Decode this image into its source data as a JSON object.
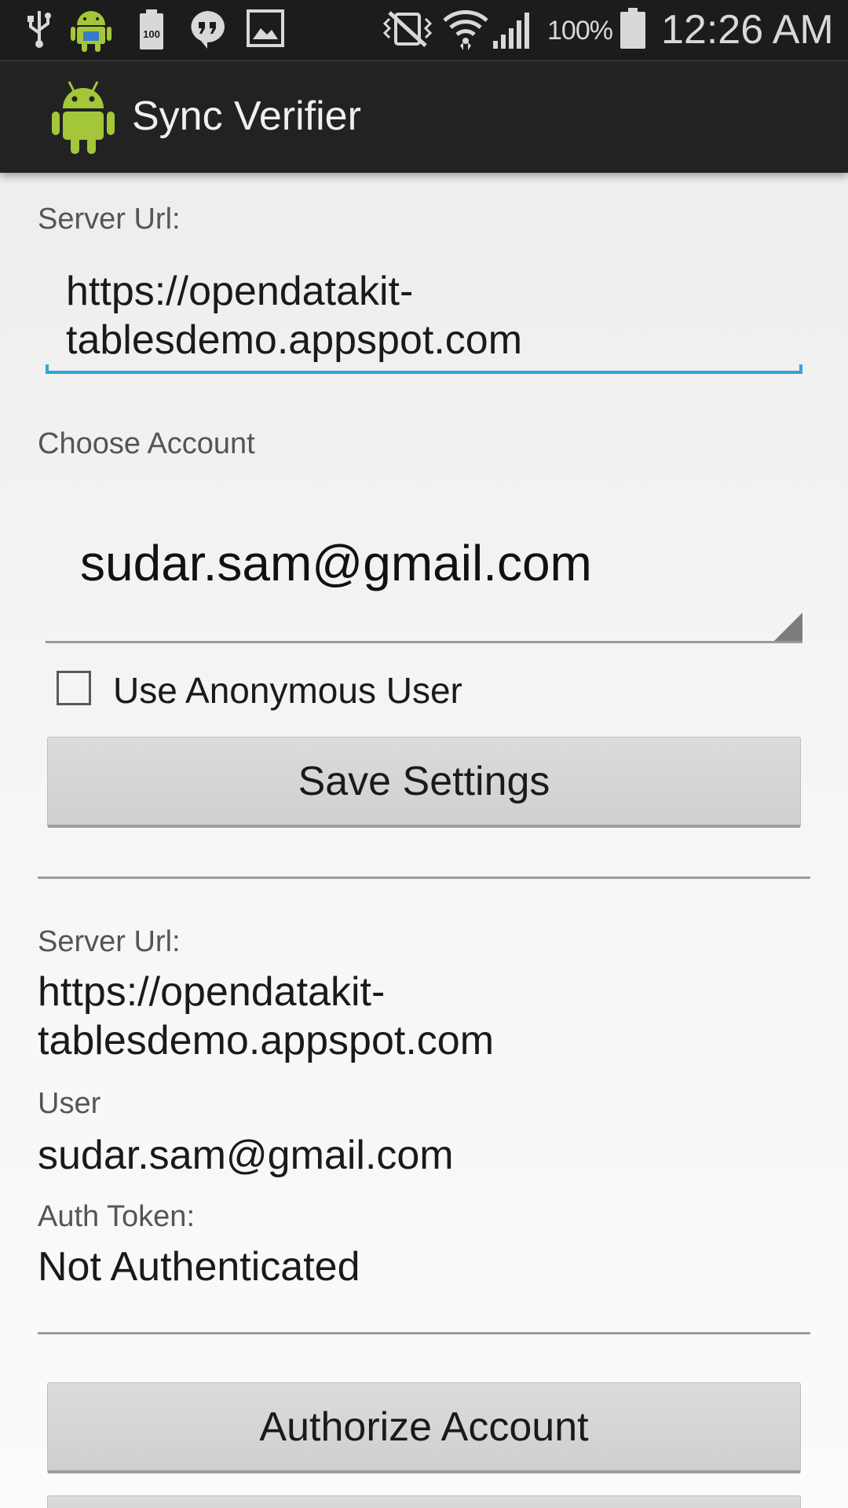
{
  "status_bar": {
    "battery_percent": "100%",
    "time": "12:26 AM",
    "icons": [
      "usb-icon",
      "android-debug-icon",
      "battery-100-notification-icon",
      "hangouts-icon",
      "gallery-icon",
      "vibrate-mute-icon",
      "wifi-icon",
      "signal-icon",
      "battery-icon"
    ]
  },
  "action_bar": {
    "title": "Sync Verifier",
    "icon": "android-icon"
  },
  "settings": {
    "server_url_label": "Server Url:",
    "server_url_value": "https://opendatakit-tablesdemo.appspot.com",
    "choose_account_label": "Choose Account",
    "selected_account": "sudar.sam@gmail.com",
    "anonymous_label": "Use Anonymous User",
    "anonymous_checked": false,
    "save_button": "Save Settings"
  },
  "current": {
    "server_url_label": "Server Url:",
    "server_url_value": "https://opendatakit-tablesdemo.appspot.com",
    "user_label": "User",
    "user_value": "sudar.sam@gmail.com",
    "auth_label": "Auth Token:",
    "auth_value": "Not Authenticated"
  },
  "actions": {
    "authorize_button": "Authorize Account"
  },
  "colors": {
    "accent": "#33a3d3",
    "action_bar": "#222222",
    "status_bar": "#1c1c1c",
    "android_green": "#a4c639"
  }
}
